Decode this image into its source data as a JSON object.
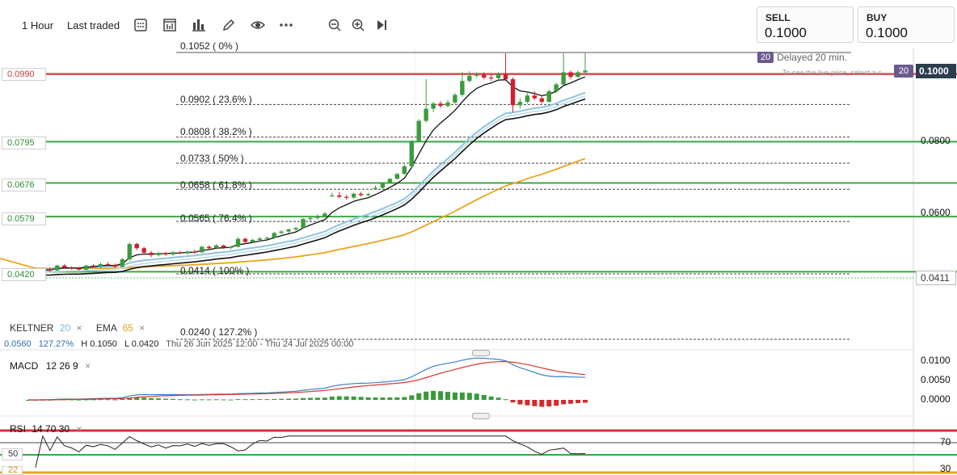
{
  "toolbar": {
    "timeframe": "1 Hour",
    "price_type": "Last traded",
    "icons": [
      "calculator-icon",
      "chart-template-icon",
      "chart-type-icon",
      "draw-pencil-icon",
      "eye-icon",
      "more-icon",
      "zoom-out-icon",
      "zoom-in-icon",
      "play-forward-icon"
    ]
  },
  "quotes": {
    "sell_label": "SELL",
    "sell_value": "0.1000",
    "buy_label": "BUY",
    "buy_value": "0.1000"
  },
  "delayed": {
    "badge": "20",
    "text": "Delayed 20 min.",
    "note": "To see the live price, select a c"
  },
  "price_tag": {
    "badge": "20",
    "value": "0.1000"
  },
  "left_levels": [
    "0.0990",
    "0.0795",
    "0.0676",
    "0.0579",
    "0.0420"
  ],
  "right_axis": {
    "boxed_top": "0.1000",
    "l1": "0.0800",
    "l2": "0.0600",
    "boxed_bottom": "0.0411"
  },
  "fib_labels": [
    "0.1052 ( 0% )",
    "0.0902 ( 23.6% )",
    "0.0808 ( 38.2% )",
    "0.0733 ( 50% )",
    "0.0658 ( 61.8% )",
    "0.0565 ( 76.4% )",
    "0.0414 ( 100% )",
    "0.0240 ( 127.2% )"
  ],
  "indicators": {
    "keltner_label": "KELTNER",
    "keltner_period": "20",
    "ema_label": "EMA",
    "ema_period": "65",
    "close": "×"
  },
  "stats": {
    "change": "0.0560",
    "change_pct": "127.27%",
    "high": "H 0.1050",
    "low": "L 0.0420",
    "range": "Thu 26 Jun 2025 12:00 - Thu 24 Jul 2025 00:00"
  },
  "macd": {
    "label": "MACD",
    "params": "12  26  9",
    "close": "×",
    "axis": [
      "0.0100",
      "0.0050",
      "0.0000"
    ]
  },
  "rsi": {
    "label": "RSI",
    "params": "14  70  30",
    "close": "×",
    "axis": [
      "70",
      "30"
    ],
    "left_level": "50",
    "left_level_2": "22"
  },
  "colors": {
    "up": "#3d9b3d",
    "down": "#d0202a",
    "keltner": "#8fc3dc",
    "ema": "#e8a420",
    "support": "#3aa844",
    "resistance": "#d84a4f"
  },
  "chart_data": {
    "type": "candlestick",
    "time_range": [
      "2025-06-26 12:00",
      "2025-07-24 00:00"
    ],
    "ylim": [
      0.024,
      0.1052
    ],
    "horizontal_levels": [
      0.099,
      0.0795,
      0.0676,
      0.0579,
      0.042
    ],
    "fibonacci": [
      {
        "pct": "0%",
        "price": 0.1052
      },
      {
        "pct": "23.6%",
        "price": 0.0902
      },
      {
        "pct": "38.2%",
        "price": 0.0808
      },
      {
        "pct": "50%",
        "price": 0.0733
      },
      {
        "pct": "61.8%",
        "price": 0.0658
      },
      {
        "pct": "76.4%",
        "price": 0.0565
      },
      {
        "pct": "100%",
        "price": 0.0414
      },
      {
        "pct": "127.2%",
        "price": 0.024
      }
    ],
    "candles": [
      {
        "o": 0.042,
        "h": 0.0425,
        "l": 0.0415,
        "c": 0.0422
      },
      {
        "o": 0.0422,
        "h": 0.0428,
        "l": 0.0418,
        "c": 0.042
      },
      {
        "o": 0.042,
        "h": 0.043,
        "l": 0.0418,
        "c": 0.0428
      },
      {
        "o": 0.0428,
        "h": 0.0432,
        "l": 0.042,
        "c": 0.0424
      },
      {
        "o": 0.0424,
        "h": 0.044,
        "l": 0.0422,
        "c": 0.0438
      },
      {
        "o": 0.0438,
        "h": 0.0442,
        "l": 0.043,
        "c": 0.0432
      },
      {
        "o": 0.0432,
        "h": 0.0436,
        "l": 0.0426,
        "c": 0.043
      },
      {
        "o": 0.043,
        "h": 0.0434,
        "l": 0.0424,
        "c": 0.0426
      },
      {
        "o": 0.0426,
        "h": 0.044,
        "l": 0.0424,
        "c": 0.0438
      },
      {
        "o": 0.0438,
        "h": 0.0442,
        "l": 0.0432,
        "c": 0.0436
      },
      {
        "o": 0.0436,
        "h": 0.0446,
        "l": 0.043,
        "c": 0.0442
      },
      {
        "o": 0.0442,
        "h": 0.0448,
        "l": 0.0436,
        "c": 0.044
      },
      {
        "o": 0.044,
        "h": 0.0444,
        "l": 0.0432,
        "c": 0.0434
      },
      {
        "o": 0.0434,
        "h": 0.046,
        "l": 0.0432,
        "c": 0.0456
      },
      {
        "o": 0.0456,
        "h": 0.0505,
        "l": 0.045,
        "c": 0.05
      },
      {
        "o": 0.05,
        "h": 0.0504,
        "l": 0.0482,
        "c": 0.0488
      },
      {
        "o": 0.0488,
        "h": 0.0492,
        "l": 0.047,
        "c": 0.0475
      },
      {
        "o": 0.0475,
        "h": 0.048,
        "l": 0.0462,
        "c": 0.0468
      },
      {
        "o": 0.0468,
        "h": 0.0478,
        "l": 0.0464,
        "c": 0.0474
      },
      {
        "o": 0.0474,
        "h": 0.0478,
        "l": 0.0466,
        "c": 0.047
      },
      {
        "o": 0.047,
        "h": 0.048,
        "l": 0.0466,
        "c": 0.0476
      },
      {
        "o": 0.0476,
        "h": 0.048,
        "l": 0.047,
        "c": 0.0473
      },
      {
        "o": 0.0473,
        "h": 0.0482,
        "l": 0.047,
        "c": 0.0478
      },
      {
        "o": 0.0478,
        "h": 0.0484,
        "l": 0.0472,
        "c": 0.0476
      },
      {
        "o": 0.0476,
        "h": 0.0495,
        "l": 0.0474,
        "c": 0.0492
      },
      {
        "o": 0.0492,
        "h": 0.0496,
        "l": 0.0484,
        "c": 0.0488
      },
      {
        "o": 0.0488,
        "h": 0.05,
        "l": 0.0484,
        "c": 0.0496
      },
      {
        "o": 0.0496,
        "h": 0.0498,
        "l": 0.0486,
        "c": 0.049
      },
      {
        "o": 0.049,
        "h": 0.0495,
        "l": 0.0484,
        "c": 0.0492
      },
      {
        "o": 0.0492,
        "h": 0.052,
        "l": 0.049,
        "c": 0.0515
      },
      {
        "o": 0.0515,
        "h": 0.0518,
        "l": 0.05,
        "c": 0.0506
      },
      {
        "o": 0.0506,
        "h": 0.0515,
        "l": 0.0502,
        "c": 0.0512
      },
      {
        "o": 0.0512,
        "h": 0.052,
        "l": 0.0508,
        "c": 0.0516
      },
      {
        "o": 0.0516,
        "h": 0.0522,
        "l": 0.0508,
        "c": 0.0518
      },
      {
        "o": 0.0518,
        "h": 0.0535,
        "l": 0.0515,
        "c": 0.0532
      },
      {
        "o": 0.0532,
        "h": 0.054,
        "l": 0.0528,
        "c": 0.0536
      },
      {
        "o": 0.0536,
        "h": 0.0545,
        "l": 0.0532,
        "c": 0.0542
      },
      {
        "o": 0.0542,
        "h": 0.055,
        "l": 0.0538,
        "c": 0.0546
      },
      {
        "o": 0.0546,
        "h": 0.0575,
        "l": 0.0544,
        "c": 0.0572
      },
      {
        "o": 0.0572,
        "h": 0.058,
        "l": 0.0566,
        "c": 0.0575
      },
      {
        "o": 0.0575,
        "h": 0.0585,
        "l": 0.057,
        "c": 0.058
      },
      {
        "o": 0.058,
        "h": 0.0592,
        "l": 0.0578,
        "c": 0.0588
      },
      {
        "o": 0.064,
        "h": 0.0648,
        "l": 0.0636,
        "c": 0.064
      },
      {
        "o": 0.064,
        "h": 0.065,
        "l": 0.0632,
        "c": 0.0636
      },
      {
        "o": 0.0636,
        "h": 0.0642,
        "l": 0.0628,
        "c": 0.0634
      },
      {
        "o": 0.0634,
        "h": 0.0648,
        "l": 0.063,
        "c": 0.0645
      },
      {
        "o": 0.0645,
        "h": 0.065,
        "l": 0.0636,
        "c": 0.0641
      },
      {
        "o": 0.0641,
        "h": 0.0648,
        "l": 0.0638,
        "c": 0.0644
      },
      {
        "o": 0.066,
        "h": 0.0668,
        "l": 0.0658,
        "c": 0.0662
      },
      {
        "o": 0.0662,
        "h": 0.0678,
        "l": 0.066,
        "c": 0.0676
      },
      {
        "o": 0.0676,
        "h": 0.069,
        "l": 0.0674,
        "c": 0.0688
      },
      {
        "o": 0.0688,
        "h": 0.0705,
        "l": 0.0686,
        "c": 0.0702
      },
      {
        "o": 0.0702,
        "h": 0.073,
        "l": 0.07,
        "c": 0.0724
      },
      {
        "o": 0.0724,
        "h": 0.08,
        "l": 0.072,
        "c": 0.0796
      },
      {
        "o": 0.0796,
        "h": 0.086,
        "l": 0.0794,
        "c": 0.0855
      },
      {
        "o": 0.0855,
        "h": 0.0975,
        "l": 0.085,
        "c": 0.089
      },
      {
        "o": 0.089,
        "h": 0.091,
        "l": 0.088,
        "c": 0.0905
      },
      {
        "o": 0.0905,
        "h": 0.0912,
        "l": 0.0892,
        "c": 0.0898
      },
      {
        "o": 0.0898,
        "h": 0.0915,
        "l": 0.0894,
        "c": 0.0908
      },
      {
        "o": 0.0908,
        "h": 0.0935,
        "l": 0.0904,
        "c": 0.093
      },
      {
        "o": 0.093,
        "h": 0.0995,
        "l": 0.0925,
        "c": 0.097
      },
      {
        "o": 0.097,
        "h": 0.0998,
        "l": 0.0965,
        "c": 0.0985
      },
      {
        "o": 0.0985,
        "h": 0.0995,
        "l": 0.098,
        "c": 0.0988
      },
      {
        "o": 0.0988,
        "h": 0.0995,
        "l": 0.0975,
        "c": 0.098
      },
      {
        "o": 0.098,
        "h": 0.099,
        "l": 0.097,
        "c": 0.0978
      },
      {
        "o": 0.0978,
        "h": 0.0995,
        "l": 0.0972,
        "c": 0.099
      },
      {
        "o": 0.099,
        "h": 0.105,
        "l": 0.097,
        "c": 0.0975
      },
      {
        "o": 0.0975,
        "h": 0.098,
        "l": 0.088,
        "c": 0.09
      },
      {
        "o": 0.09,
        "h": 0.092,
        "l": 0.089,
        "c": 0.091
      },
      {
        "o": 0.091,
        "h": 0.0935,
        "l": 0.0905,
        "c": 0.0928
      },
      {
        "o": 0.0928,
        "h": 0.094,
        "l": 0.0915,
        "c": 0.092
      },
      {
        "o": 0.092,
        "h": 0.093,
        "l": 0.0905,
        "c": 0.091
      },
      {
        "o": 0.091,
        "h": 0.0945,
        "l": 0.0908,
        "c": 0.094
      },
      {
        "o": 0.094,
        "h": 0.0965,
        "l": 0.0936,
        "c": 0.096
      },
      {
        "o": 0.096,
        "h": 0.105,
        "l": 0.0958,
        "c": 0.0995
      },
      {
        "o": 0.0995,
        "h": 0.1,
        "l": 0.0975,
        "c": 0.0982
      },
      {
        "o": 0.0982,
        "h": 0.1,
        "l": 0.0978,
        "c": 0.0995
      },
      {
        "o": 0.0995,
        "h": 0.105,
        "l": 0.099,
        "c": 0.1
      }
    ]
  }
}
